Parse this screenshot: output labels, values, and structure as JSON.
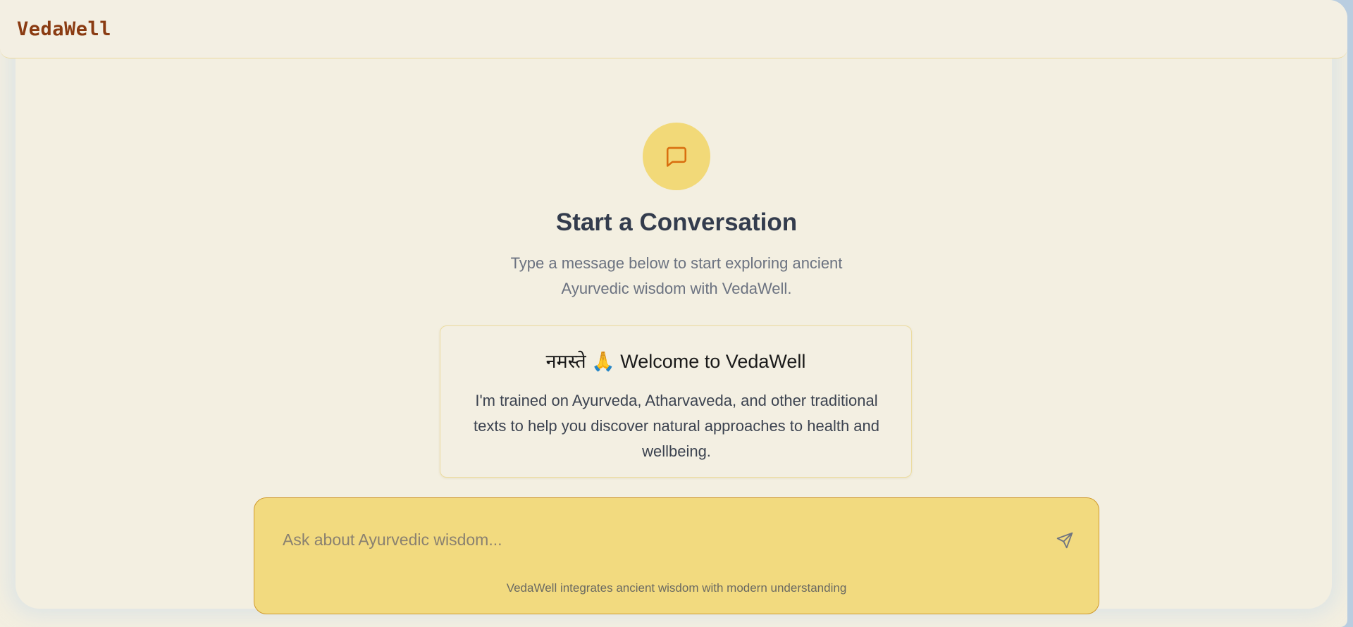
{
  "app": {
    "name": "VedaWell"
  },
  "hero": {
    "icon": "message-square-icon",
    "title": "Start a Conversation",
    "subtitle": "Type a message below to start exploring ancient Ayurvedic wisdom with VedaWell."
  },
  "welcome": {
    "title": "नमस्ते 🙏 Welcome to VedaWell",
    "body": "I'm trained on Ayurveda, Atharvaveda, and other traditional texts to help you discover natural approaches to health and wellbeing."
  },
  "composer": {
    "placeholder": "Ask about Ayurvedic wisdom...",
    "value": "",
    "send_icon": "send-icon",
    "footer": "VedaWell integrates ancient wisdom with modern understanding"
  },
  "colors": {
    "background": "#f3efe1",
    "accent": "#f2d978",
    "brand": "#8a3b12",
    "icon_stroke": "#d96f0f"
  }
}
